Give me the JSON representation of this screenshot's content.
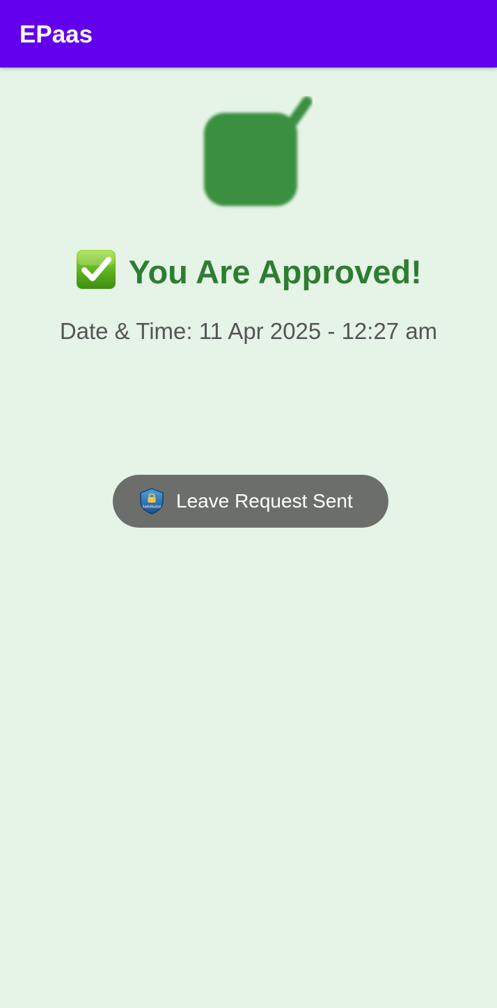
{
  "app_bar": {
    "title": "EPaas",
    "color": "#6200ee"
  },
  "main": {
    "hero_icon": "approved-badge-icon",
    "status_icon": "check-mark-emoji-icon",
    "status_text": "You Are Approved!",
    "datetime_text": "Date & Time: 11 Apr 2025 - 12:27 am",
    "background_color": "#e6f4e8",
    "status_color": "#2e7d32"
  },
  "toast": {
    "icon": "safehostel-shield-icon",
    "icon_caption": "SafeHostel",
    "message": "Leave Request Sent"
  }
}
